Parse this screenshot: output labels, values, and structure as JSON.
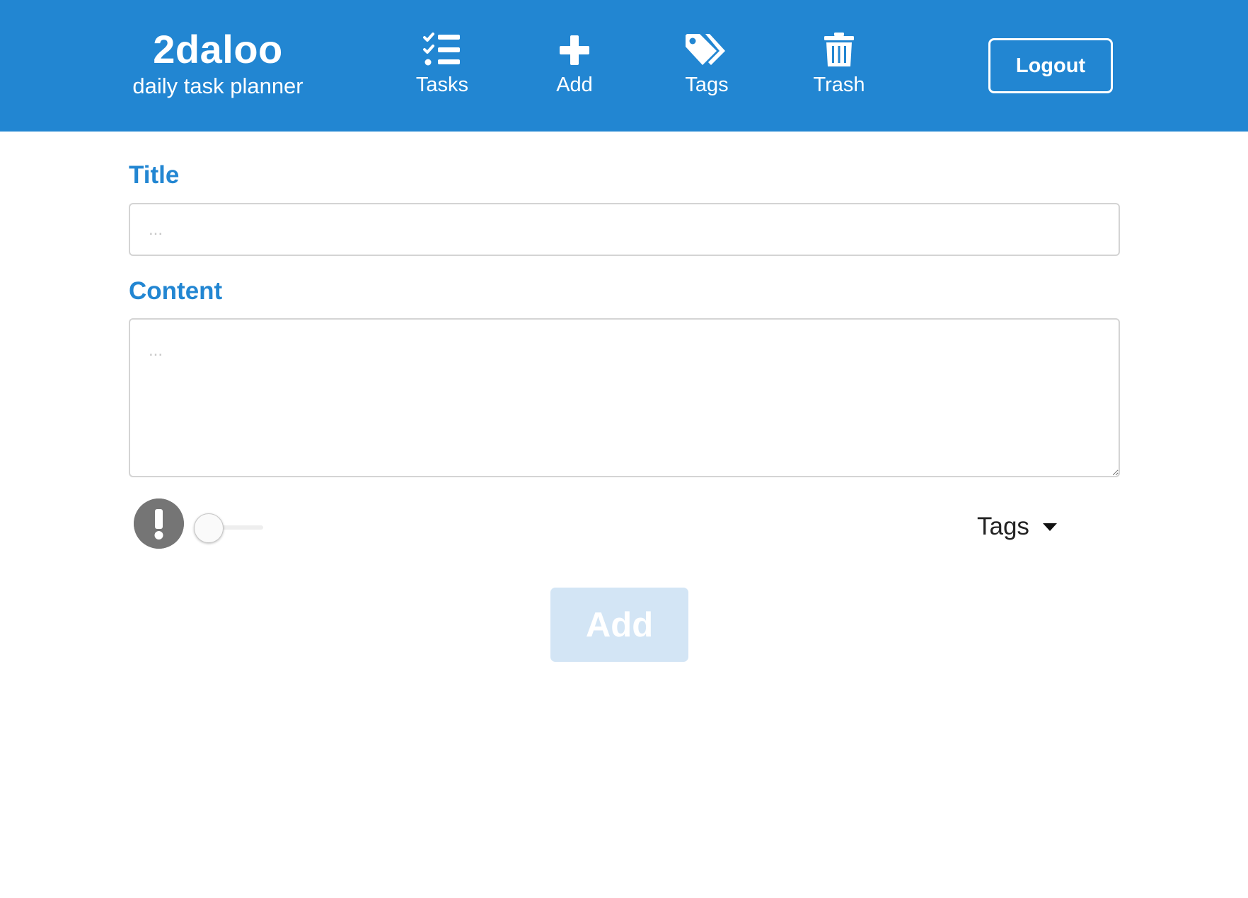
{
  "brand": {
    "name": "2daloo",
    "tagline": "daily task planner"
  },
  "nav": {
    "tasks": {
      "label": "Tasks",
      "icon": "tasks-icon"
    },
    "add": {
      "label": "Add",
      "icon": "plus-icon"
    },
    "tags": {
      "label": "Tags",
      "icon": "tags-icon"
    },
    "trash": {
      "label": "Trash",
      "icon": "trash-icon"
    }
  },
  "header": {
    "logout_label": "Logout"
  },
  "form": {
    "title_label": "Title",
    "title_placeholder": "...",
    "title_value": "",
    "content_label": "Content",
    "content_placeholder": "...",
    "content_value": "",
    "priority_icon": "exclamation-icon",
    "priority_enabled": false,
    "tags_label": "Tags",
    "add_label": "Add",
    "add_enabled": false
  },
  "colors": {
    "primary": "#2286d2",
    "label": "#2286d2",
    "disabled_button": "#d3e5f5",
    "priority_icon_bg": "#757575"
  }
}
